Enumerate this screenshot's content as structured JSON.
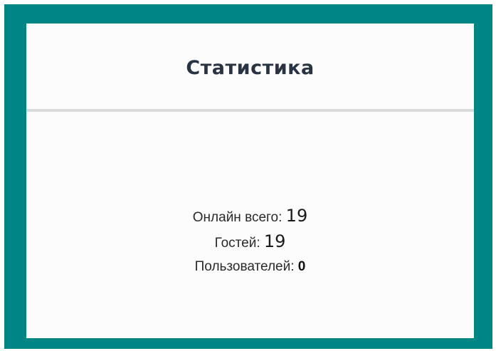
{
  "widget": {
    "title": "Статистика"
  },
  "stats": {
    "online_label": "Онлайн всего:",
    "online_value": "19",
    "guests_label": "Гостей:",
    "guests_value": "19",
    "users_label": "Пользователей:",
    "users_value": "0"
  },
  "colors": {
    "frame": "#008585",
    "panel": "#fcfcfc",
    "title": "#2a3342",
    "divider": "#d9dadb"
  }
}
